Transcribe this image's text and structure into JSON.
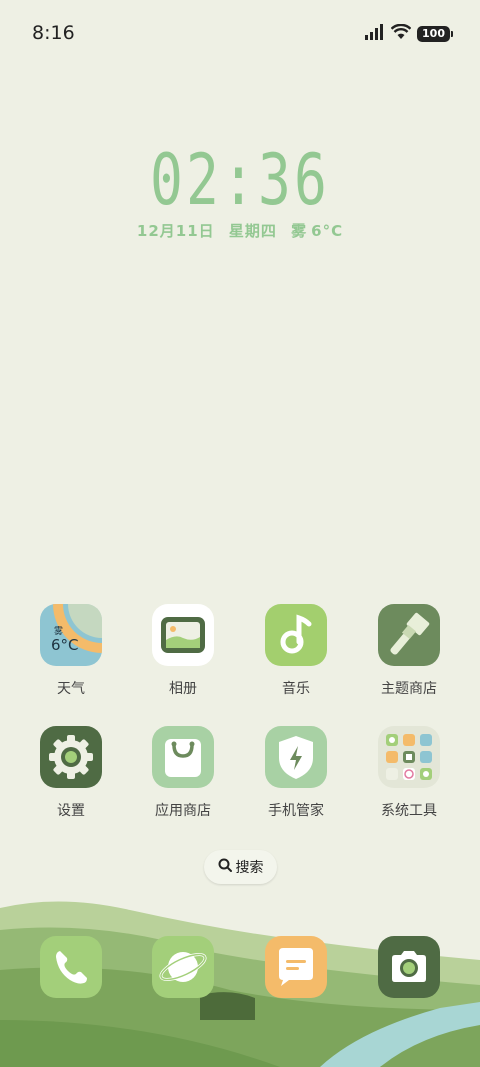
{
  "status_bar": {
    "time": "8:16",
    "battery": "100",
    "icons": [
      "signal-icon",
      "wifi-icon",
      "battery-icon"
    ]
  },
  "clock_widget": {
    "time": "02:36",
    "date": "12月11日",
    "weekday": "星期四",
    "weather": "雾",
    "temperature": "6°C"
  },
  "apps": {
    "weather": {
      "label": "天气",
      "widget_text": "雾",
      "widget_temp": "6°C"
    },
    "gallery": {
      "label": "相册"
    },
    "music": {
      "label": "音乐"
    },
    "theme_store": {
      "label": "主题商店"
    },
    "settings": {
      "label": "设置"
    },
    "app_store": {
      "label": "应用商店"
    },
    "phone_manager": {
      "label": "手机管家"
    },
    "system_tools": {
      "label": "系统工具"
    }
  },
  "search": {
    "label": "搜索"
  },
  "dock": [
    "phone-icon",
    "browser-icon",
    "messages-icon",
    "camera-icon"
  ],
  "colors": {
    "background": "#eef0e4",
    "accent_green": "#93c892",
    "dark_green": "#4f6b44",
    "light_green": "#a3cf7a",
    "orange": "#f4bb6a"
  }
}
